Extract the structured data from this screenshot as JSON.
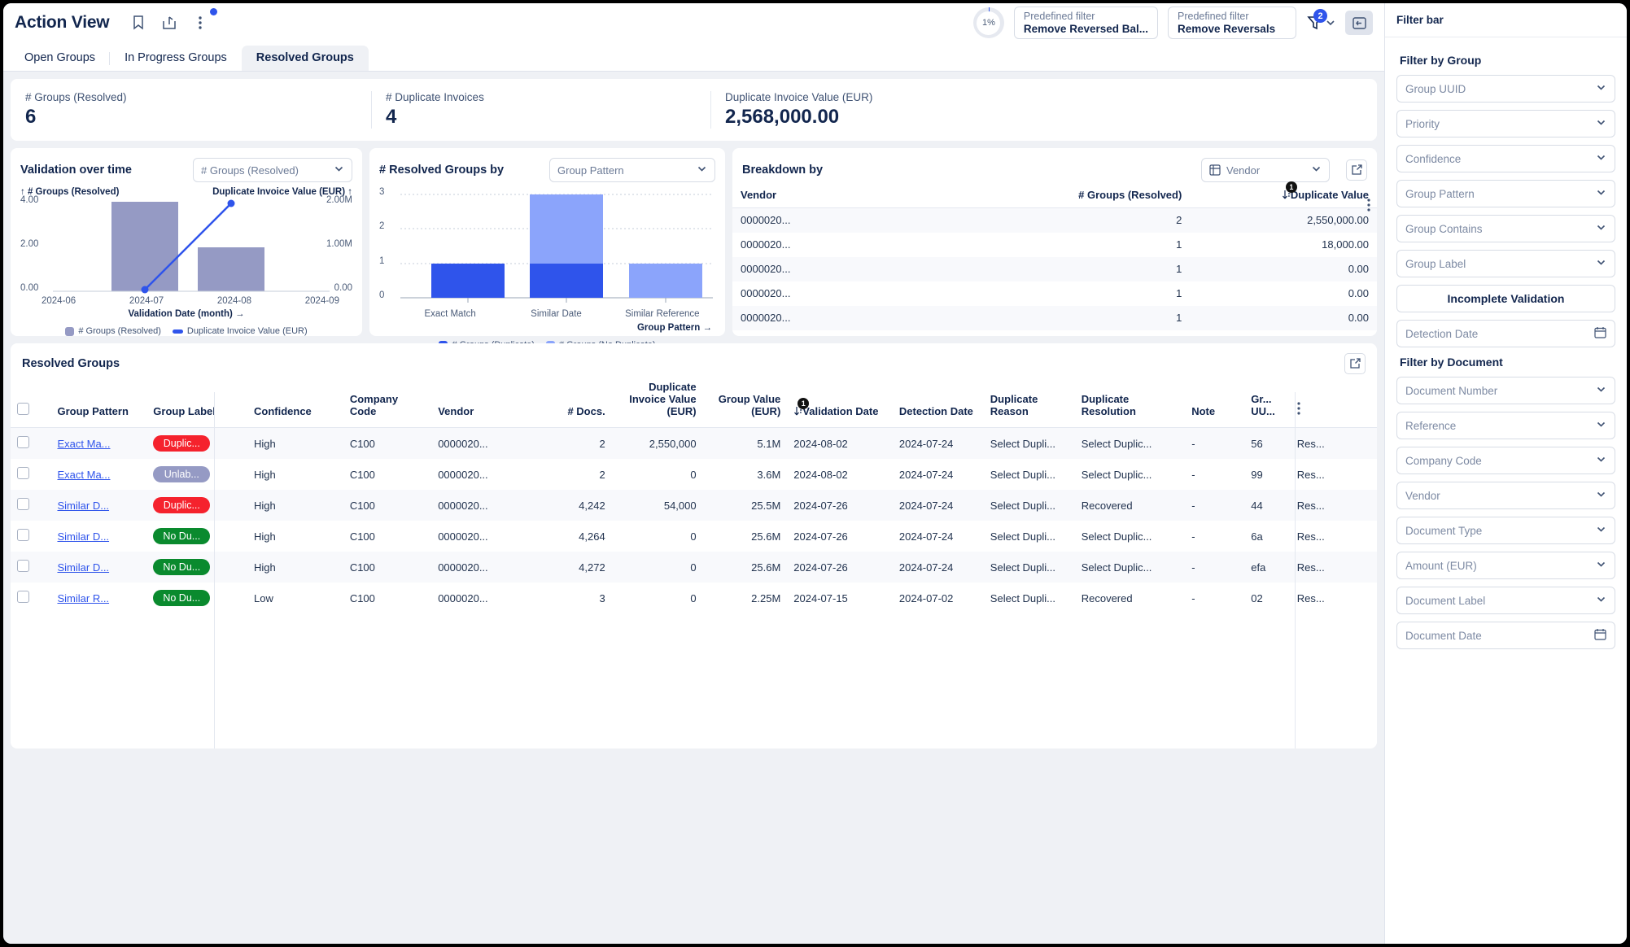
{
  "header": {
    "title": "Action View",
    "icons": [
      "bookmark-icon",
      "share-icon",
      "more-vertical-icon"
    ],
    "progress": "1%",
    "predefined_filters": [
      {
        "label": "Predefined filter",
        "value": "Remove Reversed Bal..."
      },
      {
        "label": "Predefined filter",
        "value": "Remove Reversals"
      }
    ],
    "filter_count": "2"
  },
  "tabs": [
    {
      "label": "Open Groups",
      "active": false
    },
    {
      "label": "In Progress Groups",
      "active": false
    },
    {
      "label": "Resolved Groups",
      "active": true
    }
  ],
  "kpis": [
    {
      "label": "# Groups (Resolved)",
      "value": "6"
    },
    {
      "label": "# Duplicate Invoices",
      "value": "4"
    },
    {
      "label": "Duplicate Invoice Value (EUR)",
      "value": "2,568,000.00"
    }
  ],
  "chart_data": [
    {
      "type": "bar",
      "title": "Validation over time",
      "selector": "# Groups (Resolved)",
      "categories": [
        "2024-06",
        "2024-07",
        "2024-08",
        "2024-09"
      ],
      "series": [
        {
          "name": "# Groups (Resolved)",
          "values": [
            0,
            4,
            2,
            0
          ],
          "color": "#959ac4"
        },
        {
          "name": "Duplicate Invoice Value (EUR)",
          "values": [
            null,
            0.018,
            2.55,
            null
          ],
          "color": "#2f54eb",
          "kind": "line"
        }
      ],
      "ylabel": "# Groups (Resolved)",
      "y2label": "Duplicate Invoice Value (EUR)",
      "xlabel": "Validation Date (month)",
      "yticks": [
        "4.00",
        "2.00",
        "0.00"
      ],
      "y2ticks": [
        "2.00M",
        "1.00M",
        "0.00"
      ],
      "ylim": [
        0,
        4
      ],
      "y2lim": [
        0,
        2.6
      ],
      "grid": false
    },
    {
      "type": "bar",
      "title": "# Resolved Groups by",
      "selector": "Group Pattern",
      "categories": [
        "Exact Match",
        "Similar Date",
        "Similar Reference"
      ],
      "series": [
        {
          "name": "# Groups (Duplicate)",
          "values": [
            1,
            1,
            0
          ],
          "color": "#2f54eb"
        },
        {
          "name": "# Groups (No Duplicate)",
          "values": [
            0,
            2,
            1
          ],
          "color": "#8ba4fb"
        }
      ],
      "stacked": true,
      "xlabel": "Group Pattern",
      "yticks": [
        "3",
        "2",
        "1",
        "0"
      ],
      "ylim": [
        0,
        3
      ],
      "grid": true
    }
  ],
  "breakdown": {
    "title": "Breakdown by",
    "selector": "Vendor",
    "selector_icon": "table-icon",
    "columns": [
      "Vendor",
      "# Groups (Resolved)",
      "Duplicate Value"
    ],
    "sort_badge": "1",
    "rows": [
      [
        "0000020...",
        "2",
        "2,550,000.00"
      ],
      [
        "0000020...",
        "1",
        "18,000.00"
      ],
      [
        "0000020...",
        "1",
        "0.00"
      ],
      [
        "0000020...",
        "1",
        "0.00"
      ],
      [
        "0000020...",
        "1",
        "0.00"
      ]
    ]
  },
  "table": {
    "title": "Resolved Groups",
    "sort_badge": "1",
    "columns": [
      "Group Pattern",
      "Group Label",
      "Confidence",
      "Company Code",
      "Vendor",
      "# Docs.",
      "Duplicate Invoice Value (EUR)",
      "Group Value (EUR)",
      "Validation Date",
      "Detection Date",
      "Duplicate Reason",
      "Duplicate Resolution",
      "Note",
      "Gr... UU..."
    ],
    "rows": [
      {
        "pattern": "Exact Ma...",
        "label": "Duplic...",
        "label_color": "#f5222d",
        "confidence": "High",
        "company": "C100",
        "vendor": "0000020...",
        "docs": "2",
        "dup_value": "2,550,000",
        "group_value": "5.1M",
        "validation": "2024-08-02",
        "detection": "2024-07-24",
        "reason": "Select Dupli...",
        "resolution": "Select Duplic...",
        "note": "-",
        "uuid": "56",
        "status": "Res..."
      },
      {
        "pattern": "Exact Ma...",
        "label": "Unlab...",
        "label_color": "#959ac4",
        "confidence": "High",
        "company": "C100",
        "vendor": "0000020...",
        "docs": "2",
        "dup_value": "0",
        "group_value": "3.6M",
        "validation": "2024-08-02",
        "detection": "2024-07-24",
        "reason": "Select Dupli...",
        "resolution": "Select Duplic...",
        "note": "-",
        "uuid": "99",
        "status": "Res..."
      },
      {
        "pattern": "Similar D...",
        "label": "Duplic...",
        "label_color": "#f5222d",
        "confidence": "High",
        "company": "C100",
        "vendor": "0000020...",
        "docs": "4,242",
        "dup_value": "54,000",
        "group_value": "25.5M",
        "validation": "2024-07-26",
        "detection": "2024-07-24",
        "reason": "Select Dupli...",
        "resolution": "Recovered",
        "note": "-",
        "uuid": "44",
        "status": "Res..."
      },
      {
        "pattern": "Similar D...",
        "label": "No Du...",
        "label_color": "#0a8a2e",
        "confidence": "High",
        "company": "C100",
        "vendor": "0000020...",
        "docs": "4,264",
        "dup_value": "0",
        "group_value": "25.6M",
        "validation": "2024-07-26",
        "detection": "2024-07-24",
        "reason": "Select Dupli...",
        "resolution": "Select Duplic...",
        "note": "-",
        "uuid": "6a",
        "status": "Res..."
      },
      {
        "pattern": "Similar D...",
        "label": "No Du...",
        "label_color": "#0a8a2e",
        "confidence": "High",
        "company": "C100",
        "vendor": "0000020...",
        "docs": "4,272",
        "dup_value": "0",
        "group_value": "25.6M",
        "validation": "2024-07-26",
        "detection": "2024-07-24",
        "reason": "Select Dupli...",
        "resolution": "Select Duplic...",
        "note": "-",
        "uuid": "efa",
        "status": "Res..."
      },
      {
        "pattern": "Similar R...",
        "label": "No Du...",
        "label_color": "#0a8a2e",
        "confidence": "Low",
        "company": "C100",
        "vendor": "0000020...",
        "docs": "3",
        "dup_value": "0",
        "group_value": "2.25M",
        "validation": "2024-07-15",
        "detection": "2024-07-02",
        "reason": "Select Dupli...",
        "resolution": "Recovered",
        "note": "-",
        "uuid": "02",
        "status": "Res..."
      }
    ]
  },
  "filterbar": {
    "title": "Filter bar",
    "group_section": "Filter by Group",
    "group_fields": [
      {
        "label": "Group UUID",
        "type": "select"
      },
      {
        "label": "Priority",
        "type": "select"
      },
      {
        "label": "Confidence",
        "type": "select"
      },
      {
        "label": "Group Pattern",
        "type": "select"
      },
      {
        "label": "Group Contains",
        "type": "select"
      },
      {
        "label": "Group Label",
        "type": "select"
      }
    ],
    "group_button": "Incomplete Validation",
    "group_date": {
      "label": "Detection Date",
      "type": "date"
    },
    "document_section": "Filter by Document",
    "document_fields": [
      {
        "label": "Document Number",
        "type": "select"
      },
      {
        "label": "Reference",
        "type": "select"
      },
      {
        "label": "Company Code",
        "type": "select"
      },
      {
        "label": "Vendor",
        "type": "select"
      },
      {
        "label": "Document Type",
        "type": "select"
      },
      {
        "label": "Amount (EUR)",
        "type": "select"
      },
      {
        "label": "Document Label",
        "type": "select"
      },
      {
        "label": "Document Date",
        "type": "date"
      }
    ]
  },
  "colors": {
    "accent": "#2f54eb",
    "bar_purple": "#959ac4",
    "bar_light_blue": "#8ba4fb",
    "red": "#f5222d",
    "green": "#0a8a2e",
    "text_dark": "#12264e"
  }
}
